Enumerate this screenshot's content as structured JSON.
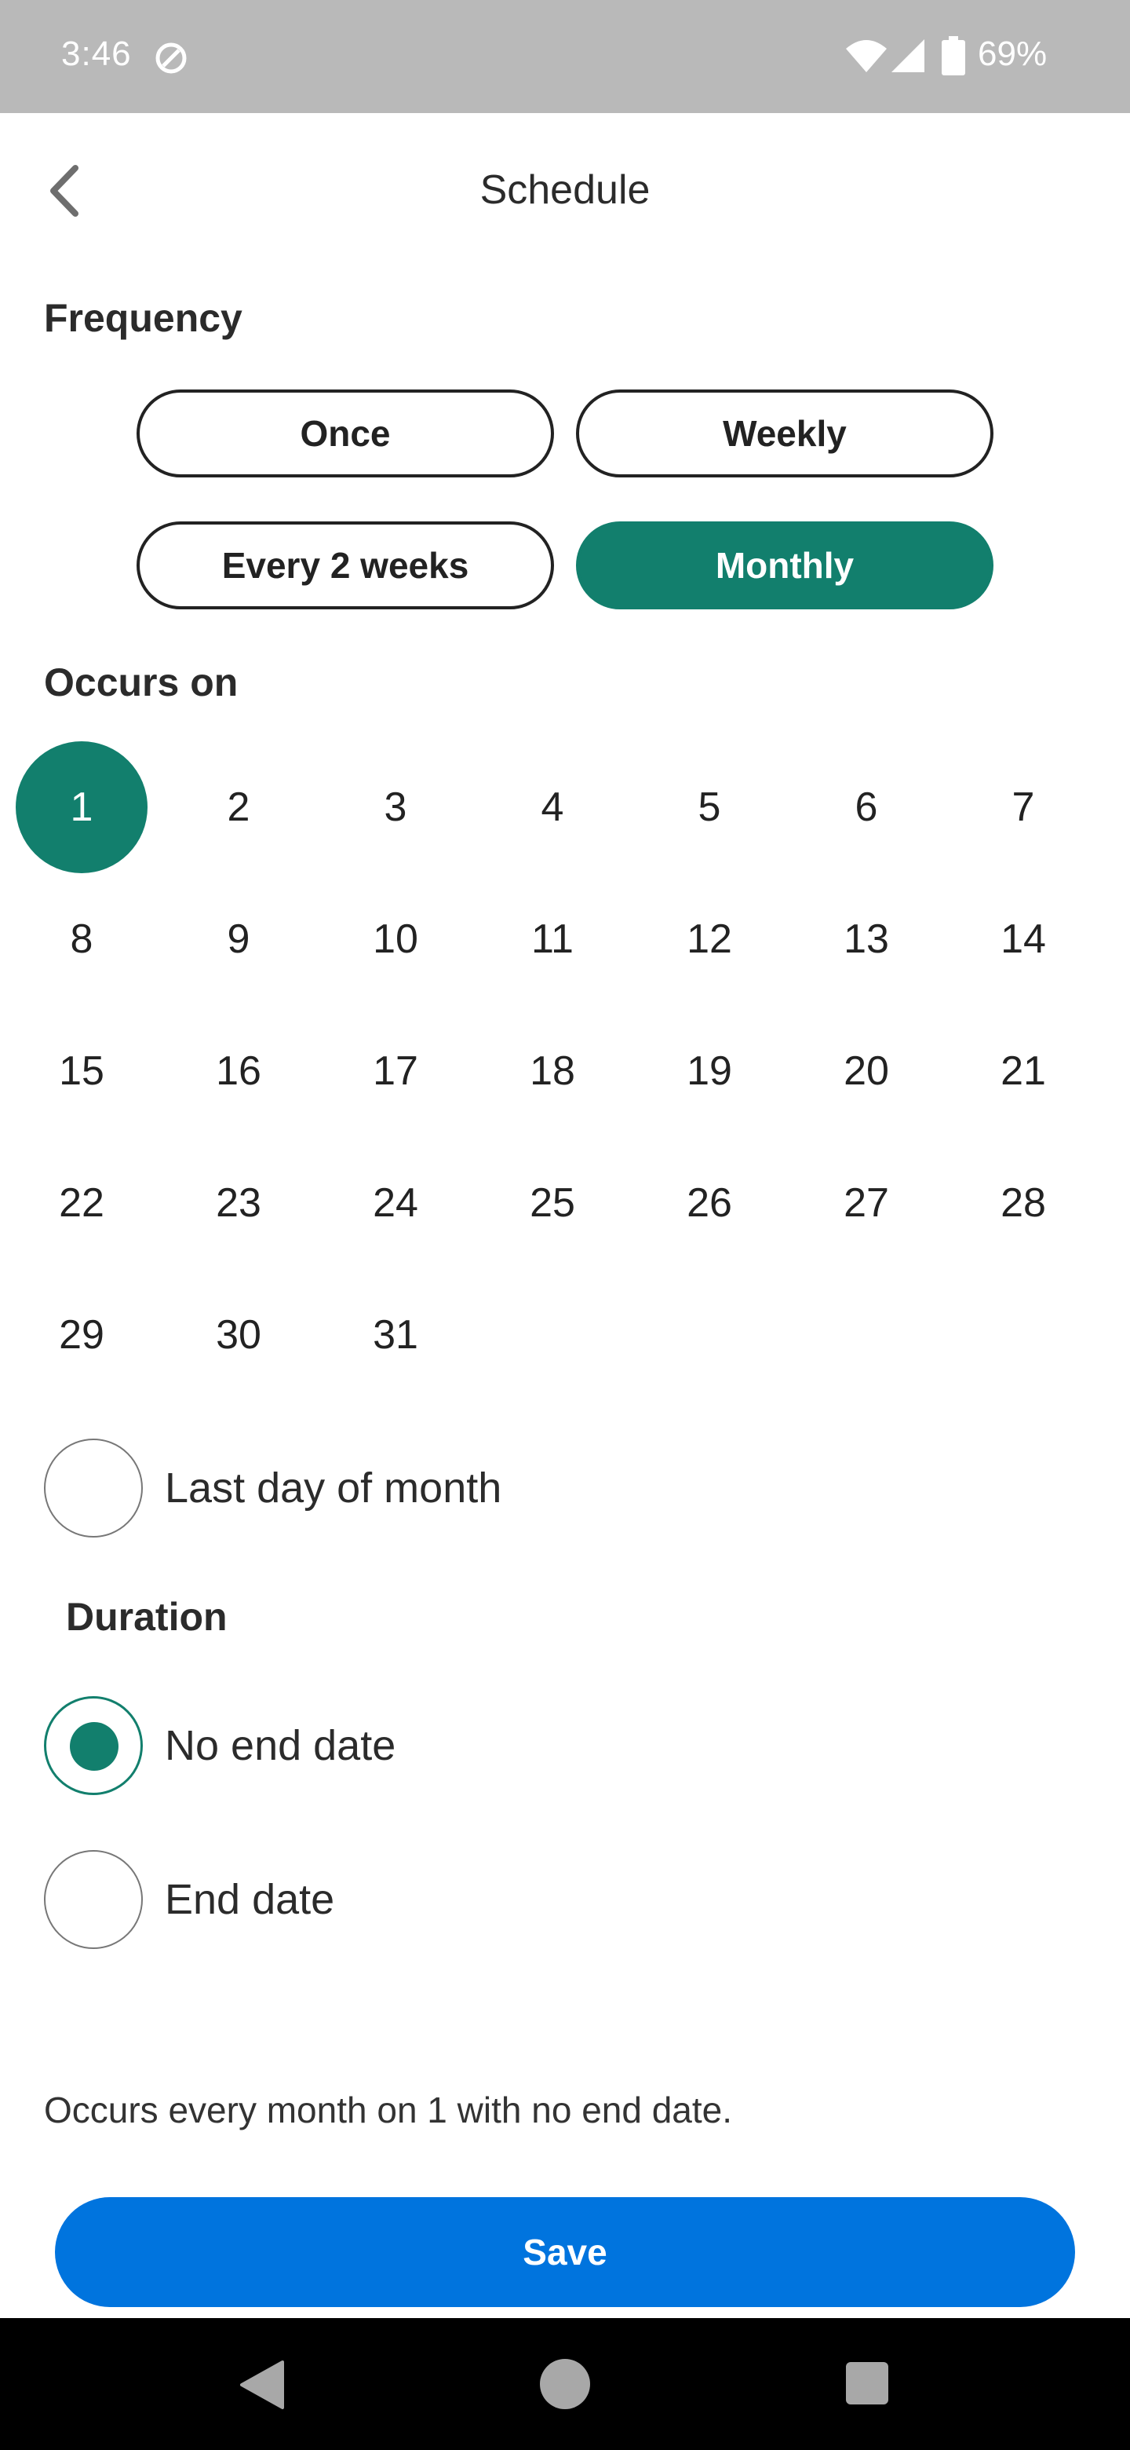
{
  "status_bar": {
    "time": "3:46",
    "battery": "69%"
  },
  "header": {
    "title": "Schedule"
  },
  "frequency": {
    "label": "Frequency",
    "options": [
      {
        "label": "Once",
        "selected": false
      },
      {
        "label": "Weekly",
        "selected": false
      },
      {
        "label": "Every 2 weeks",
        "selected": false
      },
      {
        "label": "Monthly",
        "selected": true
      }
    ]
  },
  "occurs_on": {
    "label": "Occurs on",
    "days": [
      "1",
      "2",
      "3",
      "4",
      "5",
      "6",
      "7",
      "8",
      "9",
      "10",
      "11",
      "12",
      "13",
      "14",
      "15",
      "16",
      "17",
      "18",
      "19",
      "20",
      "21",
      "22",
      "23",
      "24",
      "25",
      "26",
      "27",
      "28",
      "29",
      "30",
      "31"
    ],
    "selected_day": "1",
    "last_day_label": "Last day of month"
  },
  "duration": {
    "label": "Duration",
    "options": [
      {
        "label": "No end date",
        "checked": true
      },
      {
        "label": "End date",
        "checked": false
      }
    ]
  },
  "summary": "Occurs every month on 1 with no end date.",
  "save_label": "Save",
  "colors": {
    "accent": "#127f6d",
    "primary_button": "#0074de",
    "status_bar": "#b9b9b9"
  }
}
